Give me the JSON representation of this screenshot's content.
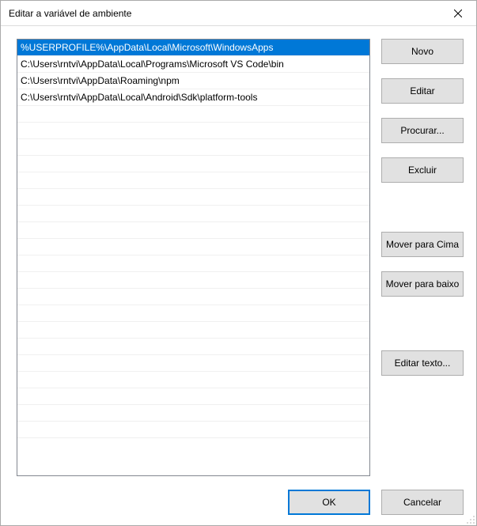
{
  "window": {
    "title": "Editar a variável de ambiente"
  },
  "list": {
    "items": [
      "%USERPROFILE%\\AppData\\Local\\Microsoft\\WindowsApps",
      "C:\\Users\\rntvi\\AppData\\Local\\Programs\\Microsoft VS Code\\bin",
      "C:\\Users\\rntvi\\AppData\\Roaming\\npm",
      "C:\\Users\\rntvi\\AppData\\Local\\Android\\Sdk\\platform-tools"
    ],
    "selected_index": 0
  },
  "buttons": {
    "novo": "Novo",
    "editar": "Editar",
    "procurar": "Procurar...",
    "excluir": "Excluir",
    "mover_cima": "Mover para Cima",
    "mover_baixo": "Mover para baixo",
    "editar_texto": "Editar texto...",
    "ok": "OK",
    "cancelar": "Cancelar"
  }
}
